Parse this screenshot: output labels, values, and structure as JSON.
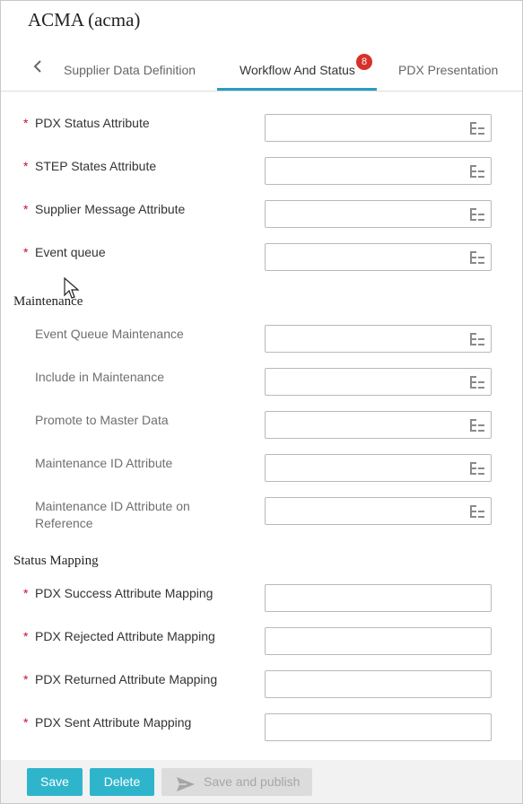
{
  "header": {
    "title": "ACMA (acma)"
  },
  "tabs": {
    "items": [
      {
        "label": "Supplier Data Definition"
      },
      {
        "label": "Workflow And Status",
        "badge": "8"
      },
      {
        "label": "PDX Presentation"
      }
    ]
  },
  "required_mark": "*",
  "fields": [
    {
      "label": "PDX Status Attribute"
    },
    {
      "label": "STEP States Attribute"
    },
    {
      "label": "Supplier Message Attribute"
    },
    {
      "label": "Event queue"
    }
  ],
  "maintenance": {
    "title": "Maintenance",
    "fields": [
      {
        "label": "Event Queue Maintenance"
      },
      {
        "label": "Include in Maintenance"
      },
      {
        "label": "Promote to Master Data"
      },
      {
        "label": "Maintenance ID Attribute"
      },
      {
        "label": "Maintenance ID Attribute on Reference"
      }
    ]
  },
  "status_mapping": {
    "title": "Status Mapping",
    "fields": [
      {
        "label": "PDX Success Attribute Mapping"
      },
      {
        "label": "PDX Rejected Attribute Mapping"
      },
      {
        "label": "PDX Returned Attribute Mapping"
      },
      {
        "label": "PDX Sent Attribute Mapping"
      }
    ]
  },
  "footer": {
    "save_label": "Save",
    "delete_label": "Delete",
    "publish_label": "Save and publish"
  },
  "icons": {
    "tab_back": "chevron-left-icon",
    "field_picker": "tree-picker-icon",
    "publish": "send-icon"
  },
  "colors": {
    "accent": "#2a9cc3",
    "button": "#2fb5cb",
    "badge": "#d6312a",
    "required": "#c8102e"
  }
}
